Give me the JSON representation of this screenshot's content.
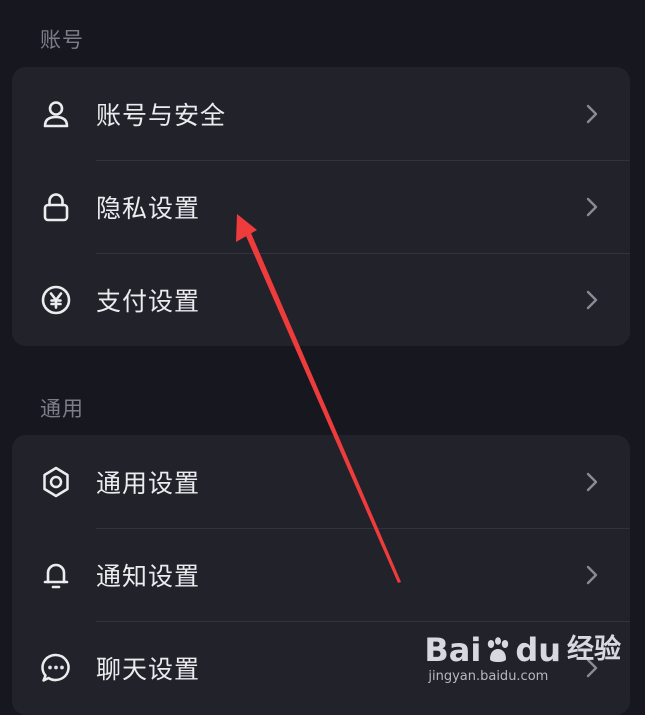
{
  "sections": [
    {
      "title": "账号",
      "items": [
        {
          "label": "账号与安全",
          "icon": "person-icon"
        },
        {
          "label": "隐私设置",
          "icon": "lock-icon"
        },
        {
          "label": "支付设置",
          "icon": "yen-icon"
        }
      ]
    },
    {
      "title": "通用",
      "items": [
        {
          "label": "通用设置",
          "icon": "gear-icon"
        },
        {
          "label": "通知设置",
          "icon": "bell-icon"
        },
        {
          "label": "聊天设置",
          "icon": "chat-bubble-icon"
        }
      ]
    }
  ],
  "annotation": {
    "color": "#ee3b3b",
    "icon": "red-arrow"
  },
  "watermark": {
    "brand_left": "Bai",
    "brand_mid": "du",
    "brand_right": "经验",
    "url": "jingyan.baidu.com"
  },
  "colors": {
    "background": "#17171f",
    "card": "#22222b",
    "text": "#ececef",
    "muted": "#7d7d88"
  }
}
